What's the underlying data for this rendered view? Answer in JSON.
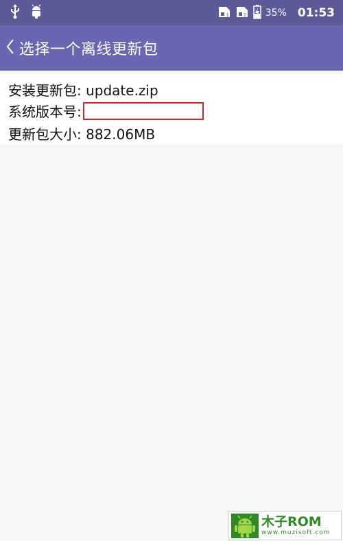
{
  "status_bar": {
    "battery_percent": "35%",
    "time": "01:53",
    "icons": [
      "usb-icon",
      "android-debug-icon",
      "sim-card-1-icon",
      "sim-card-2-icon",
      "battery-charging-icon"
    ]
  },
  "app_bar": {
    "title": "选择一个离线更新包",
    "back_icon": "chevron-left-icon"
  },
  "info": {
    "package_label": "安装更新包: update.zip",
    "version_label": "系统版本号:",
    "version_value": "",
    "size_label": "更新包大小: 882.06MB"
  },
  "watermark": {
    "brand": "木子ROM",
    "url": "www.muzisoft.com"
  },
  "colors": {
    "status_bar": "#5c5a99",
    "app_bar": "#6966b2",
    "highlight_box": "#cc2a2a",
    "watermark_green": "#2f8a25"
  }
}
